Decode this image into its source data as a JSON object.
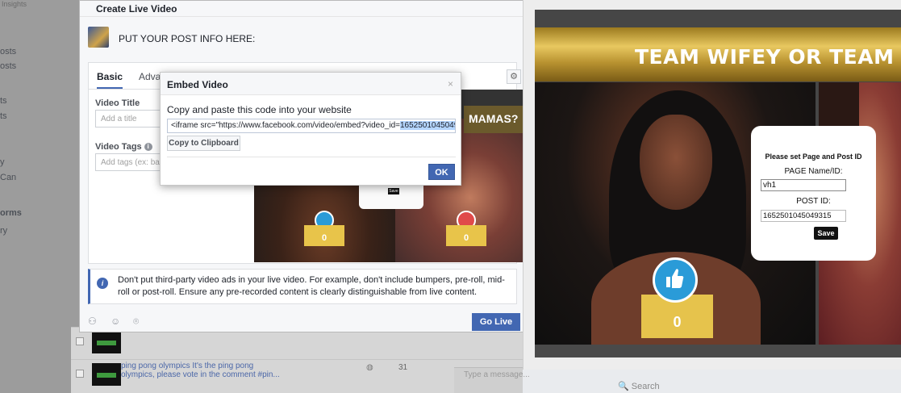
{
  "background": {
    "top_nav": "Insights",
    "sidebar_items": [
      "osts",
      "osts",
      "ts",
      "ts",
      "y",
      "Can",
      "orms",
      "ry"
    ],
    "list_rows": [
      {
        "title": "",
        "comments": ""
      },
      {
        "title": "ping pong olympics It's the ping pong olympics, please vote in the comment #pin...",
        "comments": "31"
      }
    ],
    "chat_placeholder": "Type a message...",
    "search_placeholder": "Search"
  },
  "live_dialog": {
    "title": "Create Live Video",
    "post_info": "PUT YOUR POST INFO HERE:",
    "tabs": [
      "Basic",
      "Advan"
    ],
    "video_title_label": "Video Title",
    "video_title_placeholder": "Add a title",
    "video_tags_label": "Video Tags",
    "video_tags_placeholder": "Add tags (ex: base",
    "preview_banner": "MAMAS?",
    "preview_save": "Save",
    "preview_count_left": "0",
    "preview_count_right": "0",
    "info_text": "Don't put third-party video ads in your live video. For example, don't include bumpers, pre-roll, mid-roll or post-roll. Ensure any pre-recorded content is clearly distinguishable from live content.",
    "go_live_label": "Go Live"
  },
  "embed_modal": {
    "title": "Embed Video",
    "close_glyph": "×",
    "instruction": "Copy and paste this code into your website",
    "code_prefix": "<iframe src=\"https://www.facebook.com/video/embed?video_id=",
    "code_selected": "1652501045049315",
    "copy_label": "Copy to Clipboard",
    "ok_label": "OK"
  },
  "app": {
    "banner_text": "TEAM WIFEY OR TEAM B",
    "vote_count": "0",
    "settings": {
      "title": "Please set Page and Post ID",
      "page_label": "PAGE Name/ID:",
      "page_value": "vh1",
      "post_label": "POST ID:",
      "post_value": "1652501045049315",
      "save_label": "Save"
    }
  },
  "colors": {
    "facebook_blue": "#4267b2",
    "vote_yellow": "#e6c34c",
    "thumb_blue": "#2a9bd8",
    "heart_red": "#e04a4a"
  }
}
